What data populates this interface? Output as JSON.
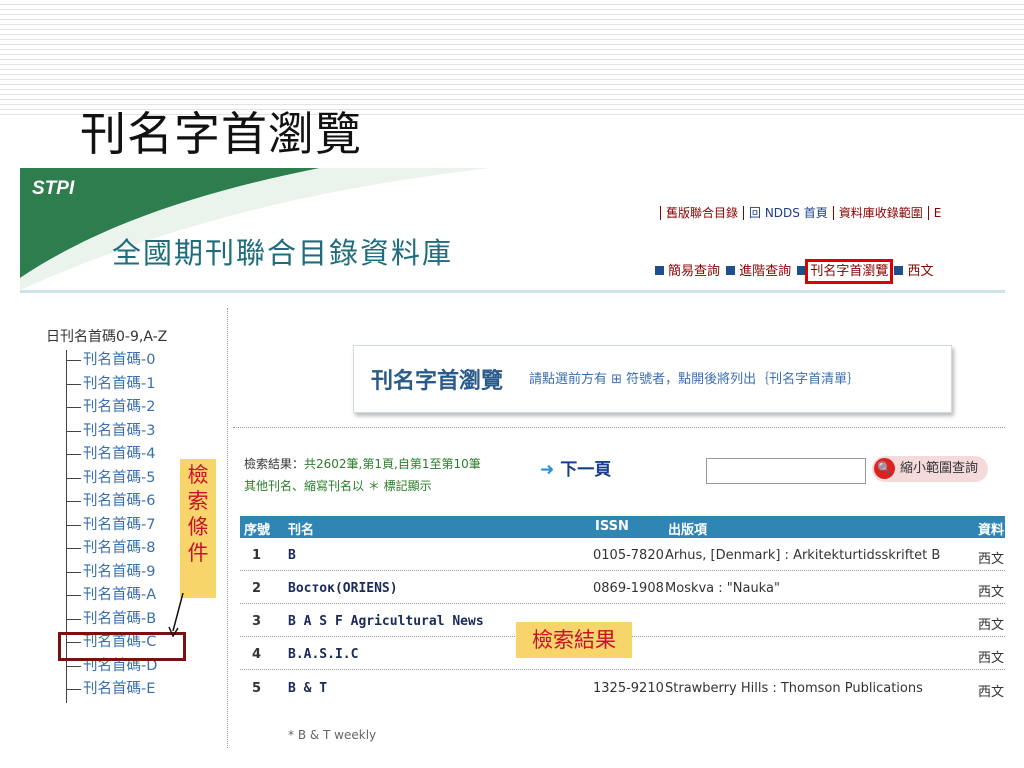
{
  "slide_title": "刊名字首瀏覽",
  "header": {
    "logo": "STPI",
    "site_title": "全國期刊聯合目錄資料庫",
    "top_links": [
      "舊版聯合目錄",
      "回 NDDS 首頁",
      "資料庫收錄範圍",
      "E"
    ],
    "nav": [
      "簡易查詢",
      "進階查詢",
      "刊名字首瀏覽",
      "西文"
    ]
  },
  "tree": {
    "root": "日刊名首碼0-9,A-Z",
    "nodes": [
      "刊名首碼-0",
      "刊名首碼-1",
      "刊名首碼-2",
      "刊名首碼-3",
      "刊名首碼-4",
      "刊名首碼-5",
      "刊名首碼-6",
      "刊名首碼-7",
      "刊名首碼-8",
      "刊名首碼-9",
      "刊名首碼-A",
      "刊名首碼-B",
      "刊名首碼-C",
      "刊名首碼-D",
      "刊名首碼-E"
    ]
  },
  "annotations": {
    "conditions": "檢索條件",
    "results": "檢索結果"
  },
  "panel": {
    "title": "刊名字首瀏覽",
    "instruction": "請點選前方有 ⊞ 符號者，點開後將列出｛刊名字首清單｝"
  },
  "results": {
    "summary_prefix": "檢索結果：",
    "summary": "共2602筆,第1頁,自第1至第10筆",
    "note": "其他刊名、縮寫刊名以 ＊ 標記顯示",
    "next_page": "下一頁",
    "search_value": "",
    "narrow_button": "縮小範圍查詢",
    "columns": [
      "序號",
      "刊名",
      "ISSN",
      "出版項",
      "資料"
    ],
    "rows": [
      {
        "num": "1",
        "title": "B",
        "issn": "0105-7820",
        "publisher": "Arhus, [Denmark] : Arkitekturtidsskriftet B",
        "source": "西文"
      },
      {
        "num": "2",
        "title": "Восток(ORIENS)",
        "issn": "0869-1908",
        "publisher": "Moskva : \"Nauka\"",
        "source": "西文"
      },
      {
        "num": "3",
        "title": "B A S F Agricultural News",
        "issn": "",
        "publisher": "",
        "source": "西文"
      },
      {
        "num": "4",
        "title": "B.A.S.I.C",
        "issn": "",
        "publisher": "",
        "source": "西文"
      },
      {
        "num": "5",
        "title": "B & T",
        "issn": "1325-9210",
        "publisher": "Strawberry Hills : Thomson Publications",
        "source": "西文"
      }
    ],
    "alt_title": "* B & T weekly"
  }
}
